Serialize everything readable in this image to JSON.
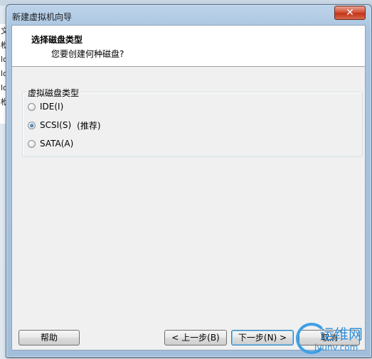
{
  "background": {
    "strip_chars": [
      "文",
      "栿",
      "lo",
      "lo",
      "lo",
      "栿"
    ]
  },
  "window": {
    "title": "新建虚拟机向导",
    "close_glyph": "✕"
  },
  "header": {
    "title": "选择磁盘类型",
    "subtitle": "您要创建何种磁盘?"
  },
  "group": {
    "label": "虚拟磁盘类型",
    "options": [
      {
        "label": "IDE(I)",
        "note": "",
        "checked": false
      },
      {
        "label": "SCSI(S)",
        "note": "(推荐)",
        "checked": true
      },
      {
        "label": "SATA(A)",
        "note": "",
        "checked": false
      }
    ]
  },
  "footer": {
    "help": "帮助",
    "back": "< 上一步(B)",
    "next": "下一步(N) >",
    "cancel": "取消"
  },
  "watermark": {
    "text": "运维网",
    "url": "iyunv.com"
  },
  "colors": {
    "accent": "#3c7fb1",
    "close": "#c3341a",
    "watermark": "#2f8fd8"
  }
}
